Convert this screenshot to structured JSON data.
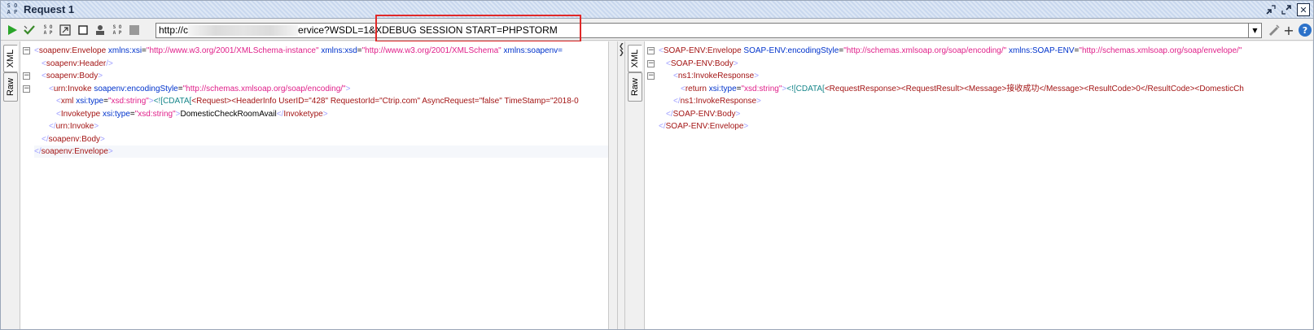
{
  "window": {
    "logo_text": "S O A P",
    "title": "Request 1"
  },
  "toolbar": {
    "icons": [
      "run-icon",
      "validate-icon",
      "soap-format-icon",
      "expand-icon",
      "clear-icon",
      "user-icon",
      "soap-format2-icon",
      "stop-icon"
    ],
    "url_prefix": "http://c",
    "url_suffix": "ervice?WSDL=",
    "url_highlighted": "1&XDEBUG_SESSION_START=PHPSTORM",
    "url_highlighted_display": "1&XDEBUG SESSION START=PHPSTORM",
    "right_icons": [
      "edit-endpoint-icon",
      "add-icon",
      "help-icon"
    ]
  },
  "request_panel": {
    "tabs": [
      "XML",
      "Raw"
    ],
    "active_tab": "XML",
    "lines": [
      {
        "indent": 0,
        "fold": "−",
        "segments": [
          {
            "t": "bracket",
            "v": "<"
          },
          {
            "t": "tag",
            "v": "soapenv:Envelope"
          },
          {
            "t": "text",
            "v": " "
          },
          {
            "t": "attr",
            "v": "xmlns:xsi"
          },
          {
            "t": "eq",
            "v": "="
          },
          {
            "t": "val",
            "v": "\"http://www.w3.org/2001/XMLSchema-instance\""
          },
          {
            "t": "text",
            "v": " "
          },
          {
            "t": "attr",
            "v": "xmlns:xsd"
          },
          {
            "t": "eq",
            "v": "="
          },
          {
            "t": "val",
            "v": "\"http://www.w3.org/2001/XMLSchema\""
          },
          {
            "t": "text",
            "v": " "
          },
          {
            "t": "attr",
            "v": "xmlns:soapenv="
          }
        ]
      },
      {
        "indent": 1,
        "fold": "",
        "segments": [
          {
            "t": "bracket",
            "v": "<"
          },
          {
            "t": "tag",
            "v": "soapenv:Header"
          },
          {
            "t": "bracket",
            "v": "/>"
          }
        ]
      },
      {
        "indent": 1,
        "fold": "−",
        "segments": [
          {
            "t": "bracket",
            "v": "<"
          },
          {
            "t": "tag",
            "v": "soapenv:Body"
          },
          {
            "t": "bracket",
            "v": ">"
          }
        ]
      },
      {
        "indent": 2,
        "fold": "−",
        "segments": [
          {
            "t": "bracket",
            "v": "<"
          },
          {
            "t": "tag",
            "v": "urn:Invoke"
          },
          {
            "t": "text",
            "v": " "
          },
          {
            "t": "attr",
            "v": "soapenv:encodingStyle"
          },
          {
            "t": "eq",
            "v": "="
          },
          {
            "t": "val",
            "v": "\"http://schemas.xmlsoap.org/soap/encoding/\""
          },
          {
            "t": "bracket",
            "v": ">"
          }
        ]
      },
      {
        "indent": 3,
        "fold": "",
        "segments": [
          {
            "t": "bracket",
            "v": "<"
          },
          {
            "t": "tag",
            "v": "xml"
          },
          {
            "t": "text",
            "v": " "
          },
          {
            "t": "attr",
            "v": "xsi:type"
          },
          {
            "t": "eq",
            "v": "="
          },
          {
            "t": "val",
            "v": "\"xsd:string\""
          },
          {
            "t": "bracket",
            "v": ">"
          },
          {
            "t": "cdata",
            "v": "<![CDATA["
          },
          {
            "t": "tag",
            "v": "<Request><HeaderInfo UserID=\"428\" RequestorId=\"Ctrip.com\" AsyncRequest=\"false\" TimeStamp=\"2018-0"
          }
        ]
      },
      {
        "indent": 3,
        "fold": "",
        "segments": [
          {
            "t": "bracket",
            "v": "<"
          },
          {
            "t": "tag",
            "v": "Invoketype"
          },
          {
            "t": "text",
            "v": " "
          },
          {
            "t": "attr",
            "v": "xsi:type"
          },
          {
            "t": "eq",
            "v": "="
          },
          {
            "t": "val",
            "v": "\"xsd:string\""
          },
          {
            "t": "bracket",
            "v": ">"
          },
          {
            "t": "text",
            "v": "DomesticCheckRoomAvail"
          },
          {
            "t": "bracket",
            "v": "</"
          },
          {
            "t": "tag",
            "v": "Invoketype"
          },
          {
            "t": "bracket",
            "v": ">"
          }
        ]
      },
      {
        "indent": 2,
        "fold": "",
        "segments": [
          {
            "t": "bracket",
            "v": "</"
          },
          {
            "t": "tag",
            "v": "urn:Invoke"
          },
          {
            "t": "bracket",
            "v": ">"
          }
        ]
      },
      {
        "indent": 1,
        "fold": "",
        "segments": [
          {
            "t": "bracket",
            "v": "</"
          },
          {
            "t": "tag",
            "v": "soapenv:Body"
          },
          {
            "t": "bracket",
            "v": ">"
          }
        ]
      },
      {
        "indent": 0,
        "fold": "",
        "segments": [
          {
            "t": "bracket",
            "v": "</"
          },
          {
            "t": "tag",
            "v": "soapenv:Envelope"
          },
          {
            "t": "bracket",
            "v": ">"
          }
        ]
      }
    ]
  },
  "response_panel": {
    "tabs": [
      "XML",
      "Raw"
    ],
    "active_tab": "XML",
    "lines": [
      {
        "indent": 0,
        "fold": "−",
        "segments": [
          {
            "t": "bracket",
            "v": "<"
          },
          {
            "t": "tag",
            "v": "SOAP-ENV:Envelope"
          },
          {
            "t": "text",
            "v": " "
          },
          {
            "t": "attr",
            "v": "SOAP-ENV:encodingStyle"
          },
          {
            "t": "eq",
            "v": "="
          },
          {
            "t": "val",
            "v": "\"http://schemas.xmlsoap.org/soap/encoding/\""
          },
          {
            "t": "text",
            "v": " "
          },
          {
            "t": "attr",
            "v": "xmlns:SOAP-ENV"
          },
          {
            "t": "eq",
            "v": "="
          },
          {
            "t": "val",
            "v": "\"http://schemas.xmlsoap.org/soap/envelope/\""
          }
        ]
      },
      {
        "indent": 1,
        "fold": "−",
        "segments": [
          {
            "t": "bracket",
            "v": "<"
          },
          {
            "t": "tag",
            "v": "SOAP-ENV:Body"
          },
          {
            "t": "bracket",
            "v": ">"
          }
        ]
      },
      {
        "indent": 2,
        "fold": "−",
        "segments": [
          {
            "t": "bracket",
            "v": "<"
          },
          {
            "t": "tag",
            "v": "ns1:InvokeResponse"
          },
          {
            "t": "bracket",
            "v": ">"
          }
        ]
      },
      {
        "indent": 3,
        "fold": "",
        "segments": [
          {
            "t": "bracket",
            "v": "<"
          },
          {
            "t": "tag",
            "v": "return"
          },
          {
            "t": "text",
            "v": " "
          },
          {
            "t": "attr",
            "v": "xsi:type"
          },
          {
            "t": "eq",
            "v": "="
          },
          {
            "t": "val",
            "v": "\"xsd:string\""
          },
          {
            "t": "bracket",
            "v": ">"
          },
          {
            "t": "cdata",
            "v": "<![CDATA["
          },
          {
            "t": "tag",
            "v": "<RequestResponse><RequestResult><Message>接收成功</Message><ResultCode>0</ResultCode><DomesticCh"
          }
        ]
      },
      {
        "indent": 2,
        "fold": "",
        "segments": [
          {
            "t": "bracket",
            "v": "</"
          },
          {
            "t": "tag",
            "v": "ns1:InvokeResponse"
          },
          {
            "t": "bracket",
            "v": ">"
          }
        ]
      },
      {
        "indent": 1,
        "fold": "",
        "segments": [
          {
            "t": "bracket",
            "v": "</"
          },
          {
            "t": "tag",
            "v": "SOAP-ENV:Body"
          },
          {
            "t": "bracket",
            "v": ">"
          }
        ]
      },
      {
        "indent": 0,
        "fold": "",
        "segments": [
          {
            "t": "bracket",
            "v": "</"
          },
          {
            "t": "tag",
            "v": "SOAP-ENV:Envelope"
          },
          {
            "t": "bracket",
            "v": ">"
          }
        ]
      }
    ]
  }
}
